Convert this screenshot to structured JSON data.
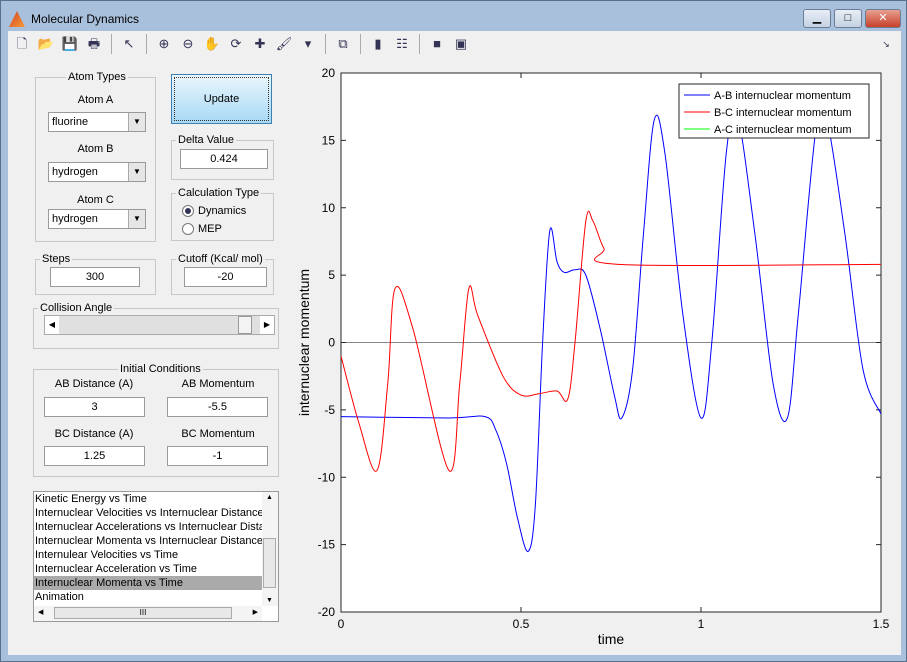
{
  "window": {
    "title": "Molecular Dynamics",
    "minimize": "▁",
    "maximize": "□",
    "close": "✕"
  },
  "toolbar": [
    {
      "icon": "new-file-icon",
      "g": "🗋"
    },
    {
      "icon": "open-folder-icon",
      "g": "📂"
    },
    {
      "icon": "save-icon",
      "g": "💾"
    },
    {
      "icon": "print-icon",
      "g": "🖶"
    },
    {
      "sep": true
    },
    {
      "icon": "pointer-icon",
      "g": "↖"
    },
    {
      "sep": true
    },
    {
      "icon": "zoom-in-icon",
      "g": "⊕"
    },
    {
      "icon": "zoom-out-icon",
      "g": "⊖"
    },
    {
      "icon": "pan-hand-icon",
      "g": "✋"
    },
    {
      "icon": "rotate-3d-icon",
      "g": "⟳"
    },
    {
      "icon": "data-cursor-icon",
      "g": "✚"
    },
    {
      "icon": "brush-icon",
      "g": "🖌"
    },
    {
      "icon": "dropdown-arrow-icon",
      "g": "▾"
    },
    {
      "sep": true
    },
    {
      "icon": "link-plot-icon",
      "g": "⧉"
    },
    {
      "sep": true
    },
    {
      "icon": "colorbar-icon",
      "g": "▮"
    },
    {
      "icon": "legend-icon",
      "g": "☷"
    },
    {
      "sep": true
    },
    {
      "icon": "hide-plot-tools-icon",
      "g": "■"
    },
    {
      "icon": "show-plot-tools-icon",
      "g": "▣"
    }
  ],
  "atom_types": {
    "label": "Atom Types",
    "a_label": "Atom A",
    "a": "fluorine",
    "b_label": "Atom B",
    "b": "hydrogen",
    "c_label": "Atom C",
    "c": "hydrogen"
  },
  "update_button": "Update",
  "delta": {
    "label": "Delta Value",
    "value": "0.424"
  },
  "calc_type": {
    "label": "Calculation Type",
    "options": [
      "Dynamics",
      "MEP"
    ],
    "selected": "Dynamics"
  },
  "steps": {
    "label": "Steps",
    "value": "300"
  },
  "cutoff": {
    "label": "Cutoff (Kcal/ mol)",
    "value": "-20"
  },
  "collision_angle": {
    "label": "Collision Angle",
    "value_fraction": 0.97
  },
  "initial_conditions": {
    "label": "Initial Conditions",
    "ab_distance_label": "AB Distance (A)",
    "ab_distance": "3",
    "ab_momentum_label": "AB Momentum",
    "ab_momentum": "-5.5",
    "bc_distance_label": "BC Distance (A)",
    "bc_distance": "1.25",
    "bc_momentum_label": "BC Momentum",
    "bc_momentum": "-1"
  },
  "plot_list": {
    "items": [
      "Kinetic Energy vs Time",
      "Internuclear Velocities vs Internuclear Distance",
      "Internuclear Accelerations vs Internuclear Distance",
      "Internuclear Momenta vs Internuclear Distance",
      "Internulear Velocities vs Time",
      "Internuclear Acceleration vs Time",
      "Internuclear Momenta vs Time",
      "Animation"
    ],
    "selected": 6,
    "hscroll_grip": "III"
  },
  "chart_data": {
    "type": "line",
    "xlabel": "time",
    "ylabel": "internuclear momentum",
    "xlim": [
      0,
      1.5
    ],
    "ylim": [
      -20,
      20
    ],
    "xticks": [
      "0",
      "0.5",
      "1",
      "1.5"
    ],
    "yticks": [
      "-20",
      "-15",
      "-10",
      "-5",
      "0",
      "5",
      "10",
      "15",
      "20"
    ],
    "legend_position": "top-right",
    "zero_line": true,
    "series": [
      {
        "name": "A-B internuclear momentum",
        "color": "#0000ff",
        "x": [
          0,
          0.3,
          0.4,
          0.43,
          0.46,
          0.49,
          0.52,
          0.54,
          0.56,
          0.58,
          0.6,
          0.62,
          0.65,
          0.68,
          0.72,
          0.76,
          0.78,
          0.81,
          0.84,
          0.87,
          0.9,
          0.95,
          1.0,
          1.03,
          1.07,
          1.1,
          1.15,
          1.2,
          1.24,
          1.27,
          1.32,
          1.35,
          1.4,
          1.45,
          1.5
        ],
        "y": [
          -5.5,
          -5.6,
          -5.5,
          -6.5,
          -9,
          -13,
          -15.5,
          -12,
          0,
          8.3,
          6,
          5.2,
          5.4,
          5,
          1,
          -4,
          -5.6,
          -2,
          8,
          16.5,
          14,
          2,
          -5.6,
          0,
          14,
          17,
          8,
          -3,
          -5.6,
          2,
          16,
          16.5,
          8,
          -2,
          -5.3
        ]
      },
      {
        "name": "B-C internuclear momentum",
        "color": "#ff0000",
        "x": [
          0,
          0.05,
          0.1,
          0.13,
          0.15,
          0.2,
          0.3,
          0.33,
          0.355,
          0.38,
          0.45,
          0.5,
          0.55,
          0.6,
          0.63,
          0.65,
          0.68,
          0.7,
          0.73,
          0.77,
          1.5
        ],
        "y": [
          -1,
          -6,
          -9.5,
          -3,
          4,
          1,
          -9.5,
          -3,
          4,
          2,
          -2.5,
          -3.9,
          -3.8,
          -3.6,
          -4.2,
          0,
          9,
          9,
          7,
          5.8,
          5.8
        ]
      },
      {
        "name": "A-C internuclear momentum",
        "color": "#00ff00",
        "x": [],
        "y": []
      }
    ]
  }
}
